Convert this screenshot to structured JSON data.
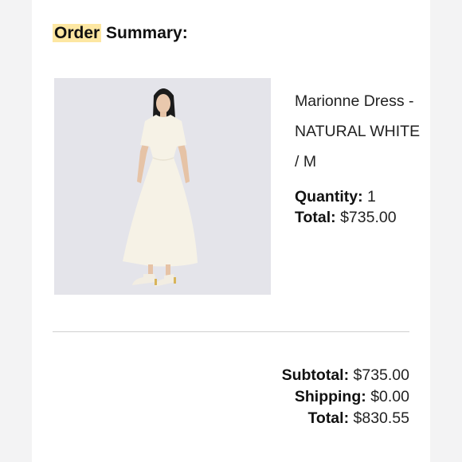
{
  "order": {
    "title_highlight": "Order",
    "title_rest": "Summary:"
  },
  "item": {
    "name_line1": "Marionne Dress -",
    "name_line2": "NATURAL WHITE",
    "name_line3": "/ M",
    "quantity_label": "Quantity:",
    "quantity_value": "1",
    "total_label": "Total:",
    "total_value": "$735.00"
  },
  "totals": {
    "subtotal_label": "Subtotal:",
    "subtotal_value": "$735.00",
    "shipping_label": "Shipping:",
    "shipping_value": "$0.00",
    "total_label": "Total:",
    "total_value": "$830.55"
  },
  "colors": {
    "highlight": "#fde7a2",
    "image_background": "#e4e4ea",
    "dress": "#f6f2e6",
    "divider": "#cfcfcf"
  }
}
